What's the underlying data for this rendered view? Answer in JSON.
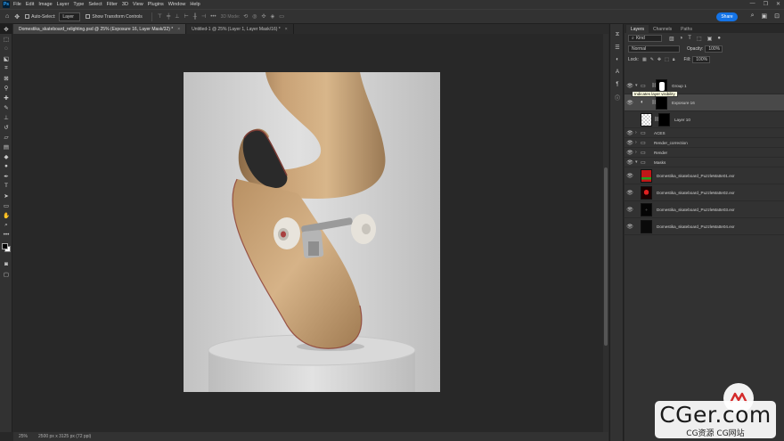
{
  "app": {
    "logo": "Ps"
  },
  "menu": [
    "File",
    "Edit",
    "Image",
    "Layer",
    "Type",
    "Select",
    "Filter",
    "3D",
    "View",
    "Plugins",
    "Window",
    "Help"
  ],
  "window_controls": {
    "minimize": "—",
    "maximize": "❐",
    "close": "✕"
  },
  "options_bar": {
    "auto_select_label": "Auto-Select:",
    "auto_select_value": "Layer",
    "transform_controls_label": "Show Transform Controls",
    "mode_3d_label": "3D Mode:",
    "share_label": "Share"
  },
  "tabs": [
    {
      "label": "Domestika_skateboard_relighting.psd @ 25% (Exposure 16, Layer Mask/32) *",
      "close": "×"
    },
    {
      "label": "Untitled-1 @ 25% (Layer 1, Layer Mask/16) *",
      "close": "×"
    }
  ],
  "status_bar": {
    "zoom": "25%",
    "doc_info": "2500 px x 3125 px (72 ppi)"
  },
  "layers_panel": {
    "tabs": [
      "Layers",
      "Channels",
      "Paths"
    ],
    "filter_kind": "Kind",
    "blend_mode": "Normal",
    "opacity_label": "Opacity:",
    "opacity_value": "100%",
    "lock_label": "Lock:",
    "fill_label": "Fill:",
    "fill_value": "100%",
    "tooltip": "Indicates layer visibility",
    "layers": [
      {
        "name": "Group 1"
      },
      {
        "name": "Exposure 16"
      },
      {
        "name": "Layer 10"
      },
      {
        "name": "ACES"
      },
      {
        "name": "Render_correction"
      },
      {
        "name": "Render"
      },
      {
        "name": "Masks"
      },
      {
        "name": "Domestika_skateboard_PuzzleMatte01.exr"
      },
      {
        "name": "Domestika_skateboard_PuzzleMatte02.exr"
      },
      {
        "name": "Domestika_skateboard_PuzzleMatte03.exr"
      },
      {
        "name": "Domestika_skateboard_PuzzleMatte04.exr"
      }
    ]
  },
  "watermark": {
    "title": "CGer.com",
    "subtitle": "CG资源 CG网站"
  }
}
